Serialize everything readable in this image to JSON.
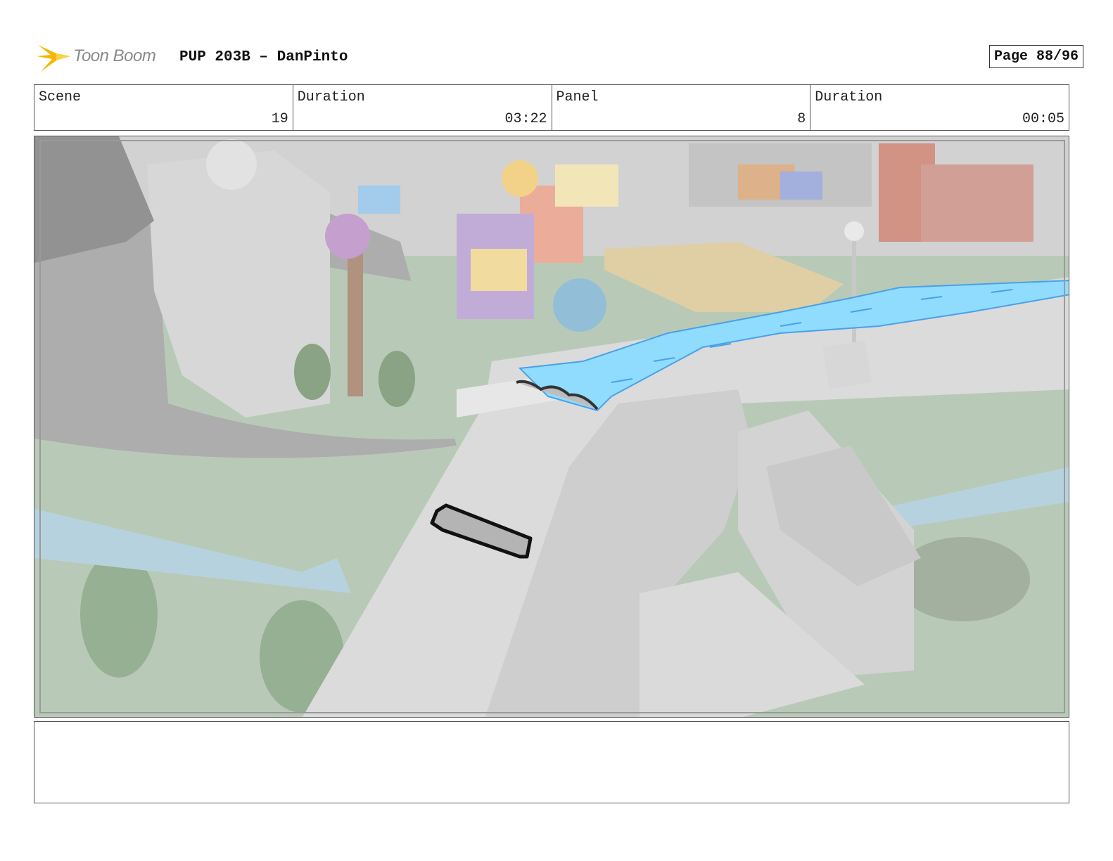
{
  "header": {
    "brand": "Toon Boom",
    "title": "PUP 203B – DanPinto",
    "page": "Page 88/96"
  },
  "info": [
    {
      "label": "Scene",
      "value": "19"
    },
    {
      "label": "Duration",
      "value": "03:22"
    },
    {
      "label": "Panel",
      "value": "8"
    },
    {
      "label": "Duration",
      "value": "00:05"
    }
  ],
  "colors": {
    "brand_yellow": "#f5b800",
    "water": "#8fdcff",
    "grass": "#9bb59a",
    "road": "#9a9a9a"
  },
  "icons": {
    "logo": "toon-boom-star-icon"
  },
  "notes": ""
}
